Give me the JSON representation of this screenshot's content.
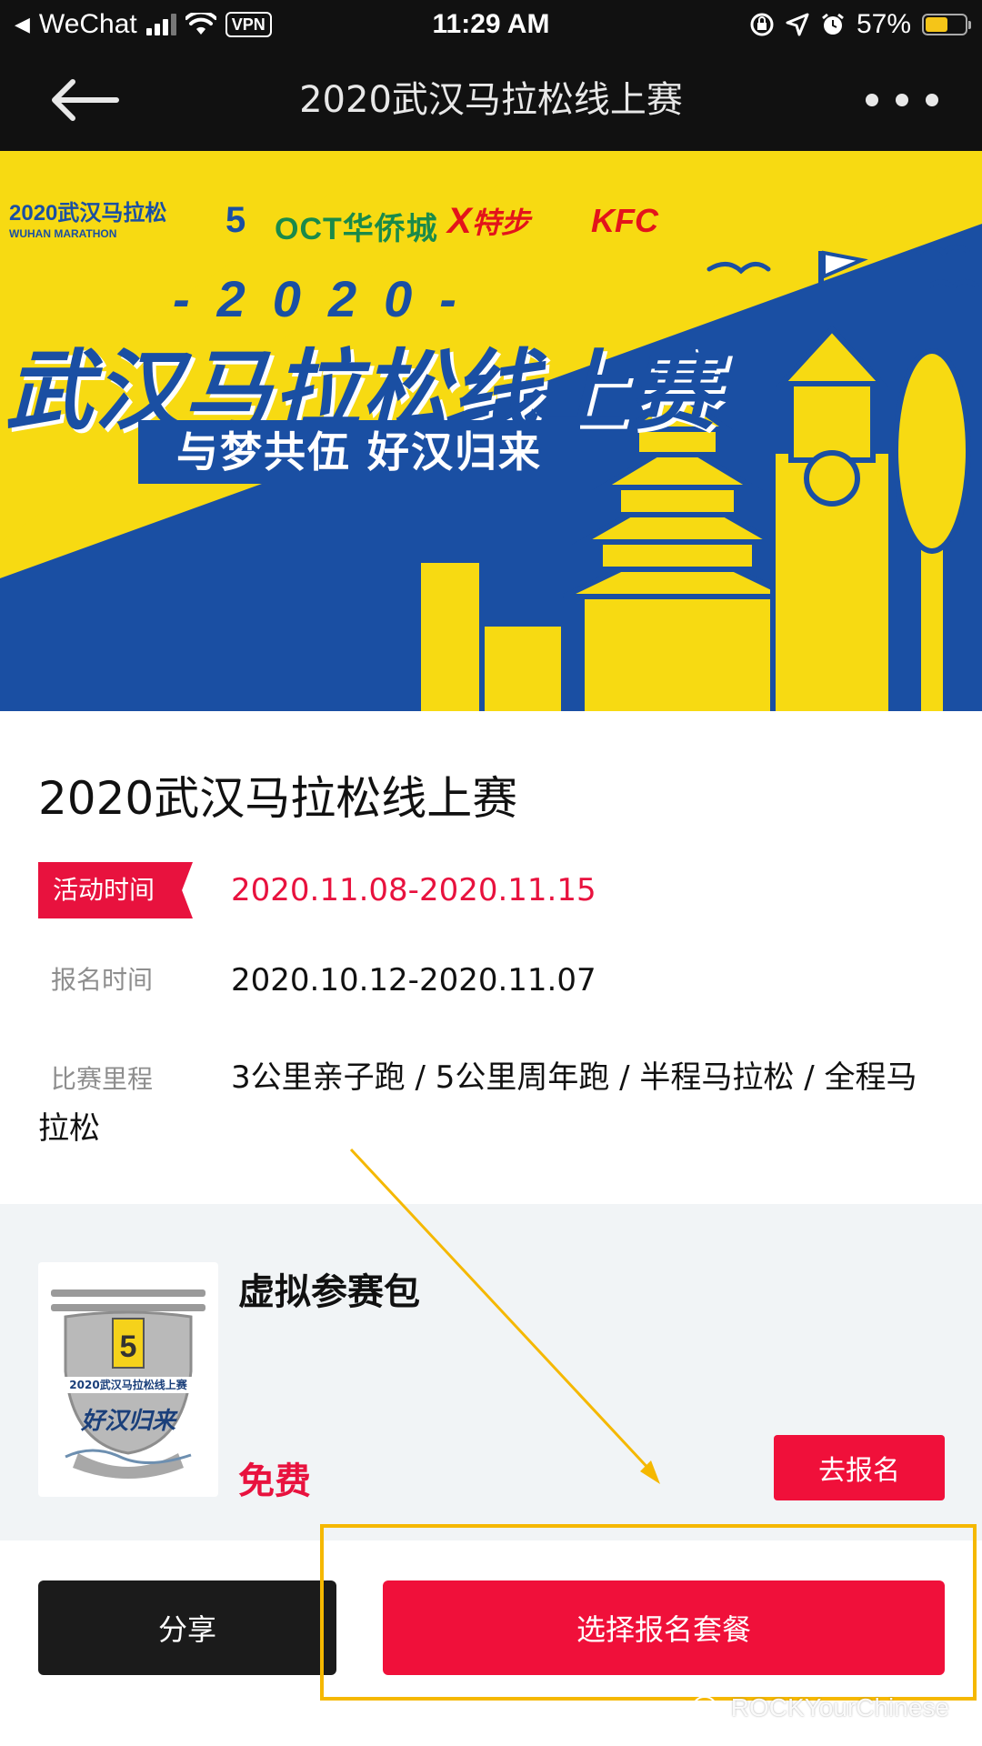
{
  "status_bar": {
    "back_app": "WeChat",
    "vpn": "VPN",
    "time": "11:29 AM",
    "battery": "57%",
    "battery_level": 0.57
  },
  "nav": {
    "title": "2020武汉马拉松线上赛"
  },
  "banner": {
    "sponsors": {
      "wuhan_cn": "2020武汉马拉松",
      "wuhan_en": "WUHAN MARATHON",
      "oct": "OCT华侨城",
      "xtep": "特步",
      "kfc": "KFC"
    },
    "year": "-2020-",
    "title": "武汉马拉松线上赛",
    "slogan": "与梦共伍  好汉归来"
  },
  "event": {
    "title": "2020武汉马拉松线上赛",
    "activity_time_label": "活动时间",
    "activity_time": "2020.11.08-2020.11.15",
    "signup_time_label": "报名时间",
    "signup_time": "2020.10.12-2020.11.07",
    "distance_label": "比赛里程",
    "distances": "3公里亲子跑 / 5公里周年跑 / 半程马拉松 / 全程马拉松"
  },
  "package": {
    "thumb_text": "2020武汉马拉松线上赛",
    "thumb_slogan": "好汉归来",
    "name": "虚拟参赛包",
    "price": "免费",
    "register_label": "去报名"
  },
  "actions": {
    "share_label": "分享",
    "choose_label": "选择报名套餐"
  },
  "watermark": "ROCKYourChinese",
  "colors": {
    "accent_red": "#f0103a",
    "banner_yellow": "#f7da12",
    "banner_blue": "#1a4fa3",
    "annotation": "#f5b800"
  }
}
